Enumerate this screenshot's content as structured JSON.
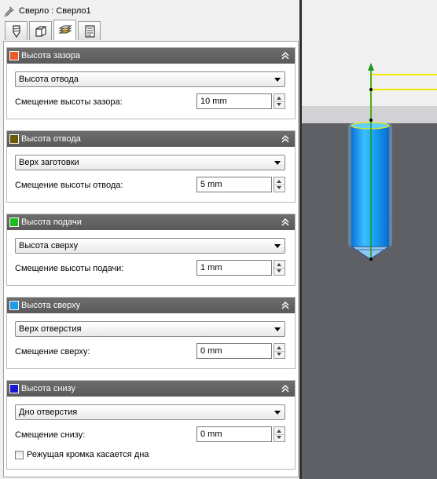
{
  "window": {
    "title": "Сверло : Сверло1"
  },
  "tabs": [
    {
      "icon": "drill-tool-icon"
    },
    {
      "icon": "stock-box-icon"
    },
    {
      "icon": "heights-icon",
      "active": true
    },
    {
      "icon": "notes-icon"
    }
  ],
  "sections": [
    {
      "title": "Высота зазора",
      "color": "#f05a28",
      "dropdown": "Высота отвода",
      "offset_label": "Смещение высоты зазора:",
      "offset_value": "10 mm"
    },
    {
      "title": "Высота отвода",
      "color": "#6b5a00",
      "dropdown": "Верх заготовки",
      "offset_label": "Смещение высоты отвода:",
      "offset_value": "5 mm"
    },
    {
      "title": "Высота подачи",
      "color": "#18c018",
      "dropdown": "Высота сверху",
      "offset_label": "Смещение высоты подачи:",
      "offset_value": "1 mm"
    },
    {
      "title": "Высота сверху",
      "color": "#1e9be8",
      "dropdown": "Верх отверстия",
      "offset_label": "Смещение сверху:",
      "offset_value": "0 mm"
    },
    {
      "title": "Высота снизу",
      "color": "#1a1ad0",
      "dropdown": "Дно отверстия",
      "offset_label": "Смещение снизу:",
      "offset_value": "0 mm",
      "checkbox_label": "Режущая кромка касается дна",
      "checkbox_checked": false
    }
  ],
  "viewport": {
    "stock_top_color": "#e8e8e8",
    "stock_side_color": "#5f6066",
    "tool_color": "#22a8ff",
    "path_color": "#f0e800",
    "axis_color": "#1a9a1a"
  }
}
